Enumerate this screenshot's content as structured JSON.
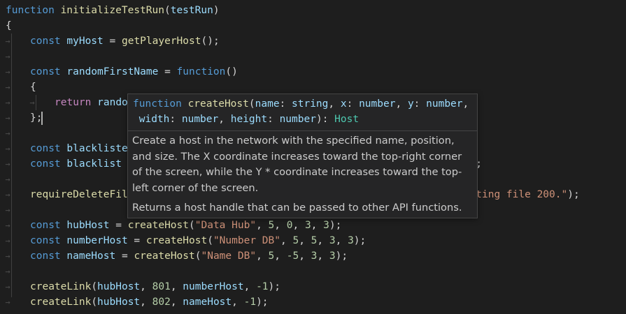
{
  "editor": {
    "lines": [
      [
        {
          "t": "function",
          "c": "kw"
        },
        {
          "t": " ",
          "c": "pl"
        },
        {
          "t": "initializeTestRun",
          "c": "fn"
        },
        {
          "t": "(",
          "c": "pl"
        },
        {
          "t": "testRun",
          "c": "var"
        },
        {
          "t": ")",
          "c": "pl"
        }
      ],
      [
        {
          "t": "{",
          "c": "pl"
        }
      ],
      [
        {
          "t": "const",
          "c": "kw"
        },
        {
          "t": " ",
          "c": "pl"
        },
        {
          "t": "myHost",
          "c": "var"
        },
        {
          "t": " = ",
          "c": "pl"
        },
        {
          "t": "getPlayerHost",
          "c": "fn"
        },
        {
          "t": "();",
          "c": "pl"
        }
      ],
      [],
      [
        {
          "t": "const",
          "c": "kw"
        },
        {
          "t": " ",
          "c": "pl"
        },
        {
          "t": "randomFirstName",
          "c": "var"
        },
        {
          "t": " = ",
          "c": "pl"
        },
        {
          "t": "function",
          "c": "kw"
        },
        {
          "t": "()",
          "c": "pl"
        }
      ],
      [
        {
          "t": "{",
          "c": "pl"
        }
      ],
      [
        {
          "t": "return",
          "c": "ctl"
        },
        {
          "t": " ",
          "c": "pl"
        },
        {
          "t": "rando",
          "c": "var"
        }
      ],
      [
        {
          "t": "};",
          "c": "pl"
        }
      ],
      [],
      [
        {
          "t": "const",
          "c": "kw"
        },
        {
          "t": " ",
          "c": "pl"
        },
        {
          "t": "blackliste",
          "c": "var"
        }
      ],
      [
        {
          "t": "const",
          "c": "kw"
        },
        {
          "t": " ",
          "c": "pl"
        },
        {
          "t": "blacklist",
          "c": "var"
        },
        {
          "t": "                                                 ",
          "c": "pl"
        },
        {
          "t": "tedName",
          "c": "var"
        },
        {
          "t": "]);",
          "c": "pl"
        }
      ],
      [],
      [
        {
          "t": "requireDeleteFil",
          "c": "fn"
        },
        {
          "t": "                                                   ",
          "c": "pl"
        },
        {
          "t": "y deleting file 200.\"",
          "c": "str"
        },
        {
          "t": ");",
          "c": "pl"
        }
      ],
      [],
      [
        {
          "t": "const",
          "c": "kw"
        },
        {
          "t": " ",
          "c": "pl"
        },
        {
          "t": "hubHost",
          "c": "var"
        },
        {
          "t": " = ",
          "c": "pl"
        },
        {
          "t": "createHost",
          "c": "fn"
        },
        {
          "t": "(",
          "c": "pl"
        },
        {
          "t": "\"Data Hub\"",
          "c": "str"
        },
        {
          "t": ", ",
          "c": "pl"
        },
        {
          "t": "5",
          "c": "num"
        },
        {
          "t": ", ",
          "c": "pl"
        },
        {
          "t": "0",
          "c": "num"
        },
        {
          "t": ", ",
          "c": "pl"
        },
        {
          "t": "3",
          "c": "num"
        },
        {
          "t": ", ",
          "c": "pl"
        },
        {
          "t": "3",
          "c": "num"
        },
        {
          "t": ");",
          "c": "pl"
        }
      ],
      [
        {
          "t": "const",
          "c": "kw"
        },
        {
          "t": " ",
          "c": "pl"
        },
        {
          "t": "numberHost",
          "c": "var"
        },
        {
          "t": " = ",
          "c": "pl"
        },
        {
          "t": "createHost",
          "c": "fn"
        },
        {
          "t": "(",
          "c": "pl"
        },
        {
          "t": "\"Number DB\"",
          "c": "str"
        },
        {
          "t": ", ",
          "c": "pl"
        },
        {
          "t": "5",
          "c": "num"
        },
        {
          "t": ", ",
          "c": "pl"
        },
        {
          "t": "5",
          "c": "num"
        },
        {
          "t": ", ",
          "c": "pl"
        },
        {
          "t": "3",
          "c": "num"
        },
        {
          "t": ", ",
          "c": "pl"
        },
        {
          "t": "3",
          "c": "num"
        },
        {
          "t": ");",
          "c": "pl"
        }
      ],
      [
        {
          "t": "const",
          "c": "kw"
        },
        {
          "t": " ",
          "c": "pl"
        },
        {
          "t": "nameHost",
          "c": "var"
        },
        {
          "t": " = ",
          "c": "pl"
        },
        {
          "t": "createHost",
          "c": "fn"
        },
        {
          "t": "(",
          "c": "pl"
        },
        {
          "t": "\"Name DB\"",
          "c": "str"
        },
        {
          "t": ", ",
          "c": "pl"
        },
        {
          "t": "5",
          "c": "num"
        },
        {
          "t": ", ",
          "c": "pl"
        },
        {
          "t": "-5",
          "c": "num"
        },
        {
          "t": ", ",
          "c": "pl"
        },
        {
          "t": "3",
          "c": "num"
        },
        {
          "t": ", ",
          "c": "pl"
        },
        {
          "t": "3",
          "c": "num"
        },
        {
          "t": ");",
          "c": "pl"
        }
      ],
      [],
      [
        {
          "t": "createLink",
          "c": "fn"
        },
        {
          "t": "(",
          "c": "pl"
        },
        {
          "t": "hubHost",
          "c": "var"
        },
        {
          "t": ", ",
          "c": "pl"
        },
        {
          "t": "801",
          "c": "num"
        },
        {
          "t": ", ",
          "c": "pl"
        },
        {
          "t": "numberHost",
          "c": "var"
        },
        {
          "t": ", ",
          "c": "pl"
        },
        {
          "t": "-1",
          "c": "num"
        },
        {
          "t": ");",
          "c": "pl"
        }
      ],
      [
        {
          "t": "createLink",
          "c": "fn"
        },
        {
          "t": "(",
          "c": "pl"
        },
        {
          "t": "hubHost",
          "c": "var"
        },
        {
          "t": ", ",
          "c": "pl"
        },
        {
          "t": "802",
          "c": "num"
        },
        {
          "t": ", ",
          "c": "pl"
        },
        {
          "t": "nameHost",
          "c": "var"
        },
        {
          "t": ", ",
          "c": "pl"
        },
        {
          "t": "-1",
          "c": "num"
        },
        {
          "t": ");",
          "c": "pl"
        }
      ]
    ],
    "whitespace_arrow": "→"
  },
  "hover": {
    "signature": [
      {
        "t": "function",
        "c": "kw"
      },
      {
        "t": " ",
        "c": "pl"
      },
      {
        "t": "createHost",
        "c": "fn"
      },
      {
        "t": "(",
        "c": "pl"
      },
      {
        "t": "name",
        "c": "var"
      },
      {
        "t": ": ",
        "c": "pl"
      },
      {
        "t": "string",
        "c": "var"
      },
      {
        "t": ", ",
        "c": "pl"
      },
      {
        "t": "x",
        "c": "var"
      },
      {
        "t": ": ",
        "c": "pl"
      },
      {
        "t": "number",
        "c": "var"
      },
      {
        "t": ", ",
        "c": "pl"
      },
      {
        "t": "y",
        "c": "var"
      },
      {
        "t": ": ",
        "c": "pl"
      },
      {
        "t": "number",
        "c": "var"
      },
      {
        "t": ",",
        "c": "pl"
      },
      {
        "t": "\n ",
        "c": "pl"
      },
      {
        "t": "width",
        "c": "var"
      },
      {
        "t": ": ",
        "c": "pl"
      },
      {
        "t": "number",
        "c": "var"
      },
      {
        "t": ", ",
        "c": "pl"
      },
      {
        "t": "height",
        "c": "var"
      },
      {
        "t": ": ",
        "c": "pl"
      },
      {
        "t": "number",
        "c": "var"
      },
      {
        "t": "): ",
        "c": "pl"
      },
      {
        "t": "Host",
        "c": "type"
      }
    ],
    "doc_paragraph_1": "Create a host in the network with the specified name, position, and size. The X coordinate increases toward the top-right corner of the screen, while the Y * coordinate increases toward the top-left corner of the screen.",
    "doc_paragraph_2": "Returns a host handle that can be passed to other API functions."
  },
  "colors": {
    "background": "#1e1e1e",
    "keyword": "#569cd6",
    "function": "#dcdcaa",
    "variable": "#9cdcfe",
    "string": "#ce9178",
    "number": "#b5cea8",
    "control": "#c586c0",
    "type": "#4ec9b0",
    "hover_background": "#252526"
  }
}
